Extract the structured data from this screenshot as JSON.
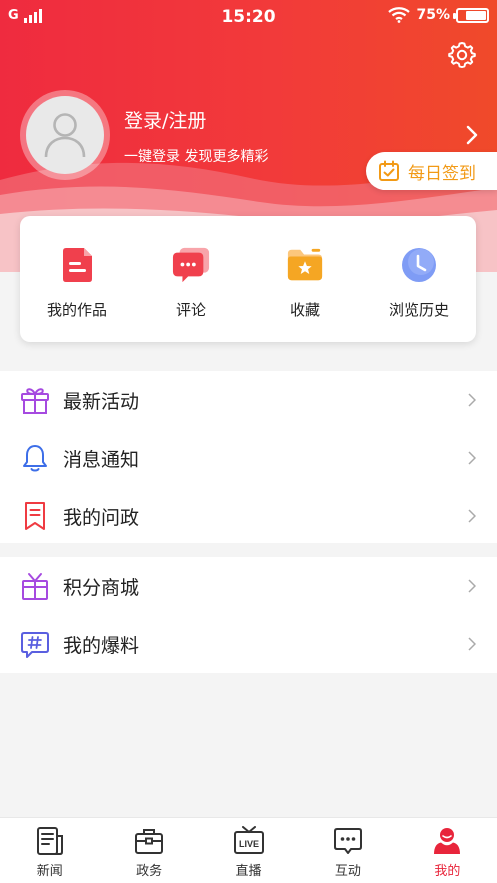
{
  "status_bar": {
    "network": "G",
    "time": "15:20",
    "battery": "75%",
    "battery_level": 0.75
  },
  "profile": {
    "title": "登录/注册",
    "subtitle": "一键登录 发现更多精彩",
    "checkin_label": "每日签到"
  },
  "quick_actions": [
    {
      "label": "我的作品",
      "icon": "works-icon"
    },
    {
      "label": "评论",
      "icon": "comment-icon"
    },
    {
      "label": "收藏",
      "icon": "favorites-folder-icon"
    },
    {
      "label": "浏览历史",
      "icon": "clock-icon"
    }
  ],
  "menu_group_1": [
    {
      "label": "最新活动",
      "icon": "gift-icon"
    },
    {
      "label": "消息通知",
      "icon": "bell-icon"
    },
    {
      "label": "我的问政",
      "icon": "bookmark-icon"
    }
  ],
  "menu_group_2": [
    {
      "label": "积分商城",
      "icon": "gift-box-icon"
    },
    {
      "label": "我的爆料",
      "icon": "hashtag-icon"
    }
  ],
  "tabs": [
    {
      "label": "新闻",
      "icon": "newspaper-icon"
    },
    {
      "label": "政务",
      "icon": "briefcase-icon"
    },
    {
      "label": "直播",
      "icon": "live-tv-icon",
      "icon_text": "LIVE"
    },
    {
      "label": "互动",
      "icon": "chat-icon"
    },
    {
      "label": "我的",
      "icon": "user-icon",
      "active": true
    }
  ],
  "colors": {
    "accent": "#e8253b",
    "checkin": "#f29a16"
  }
}
